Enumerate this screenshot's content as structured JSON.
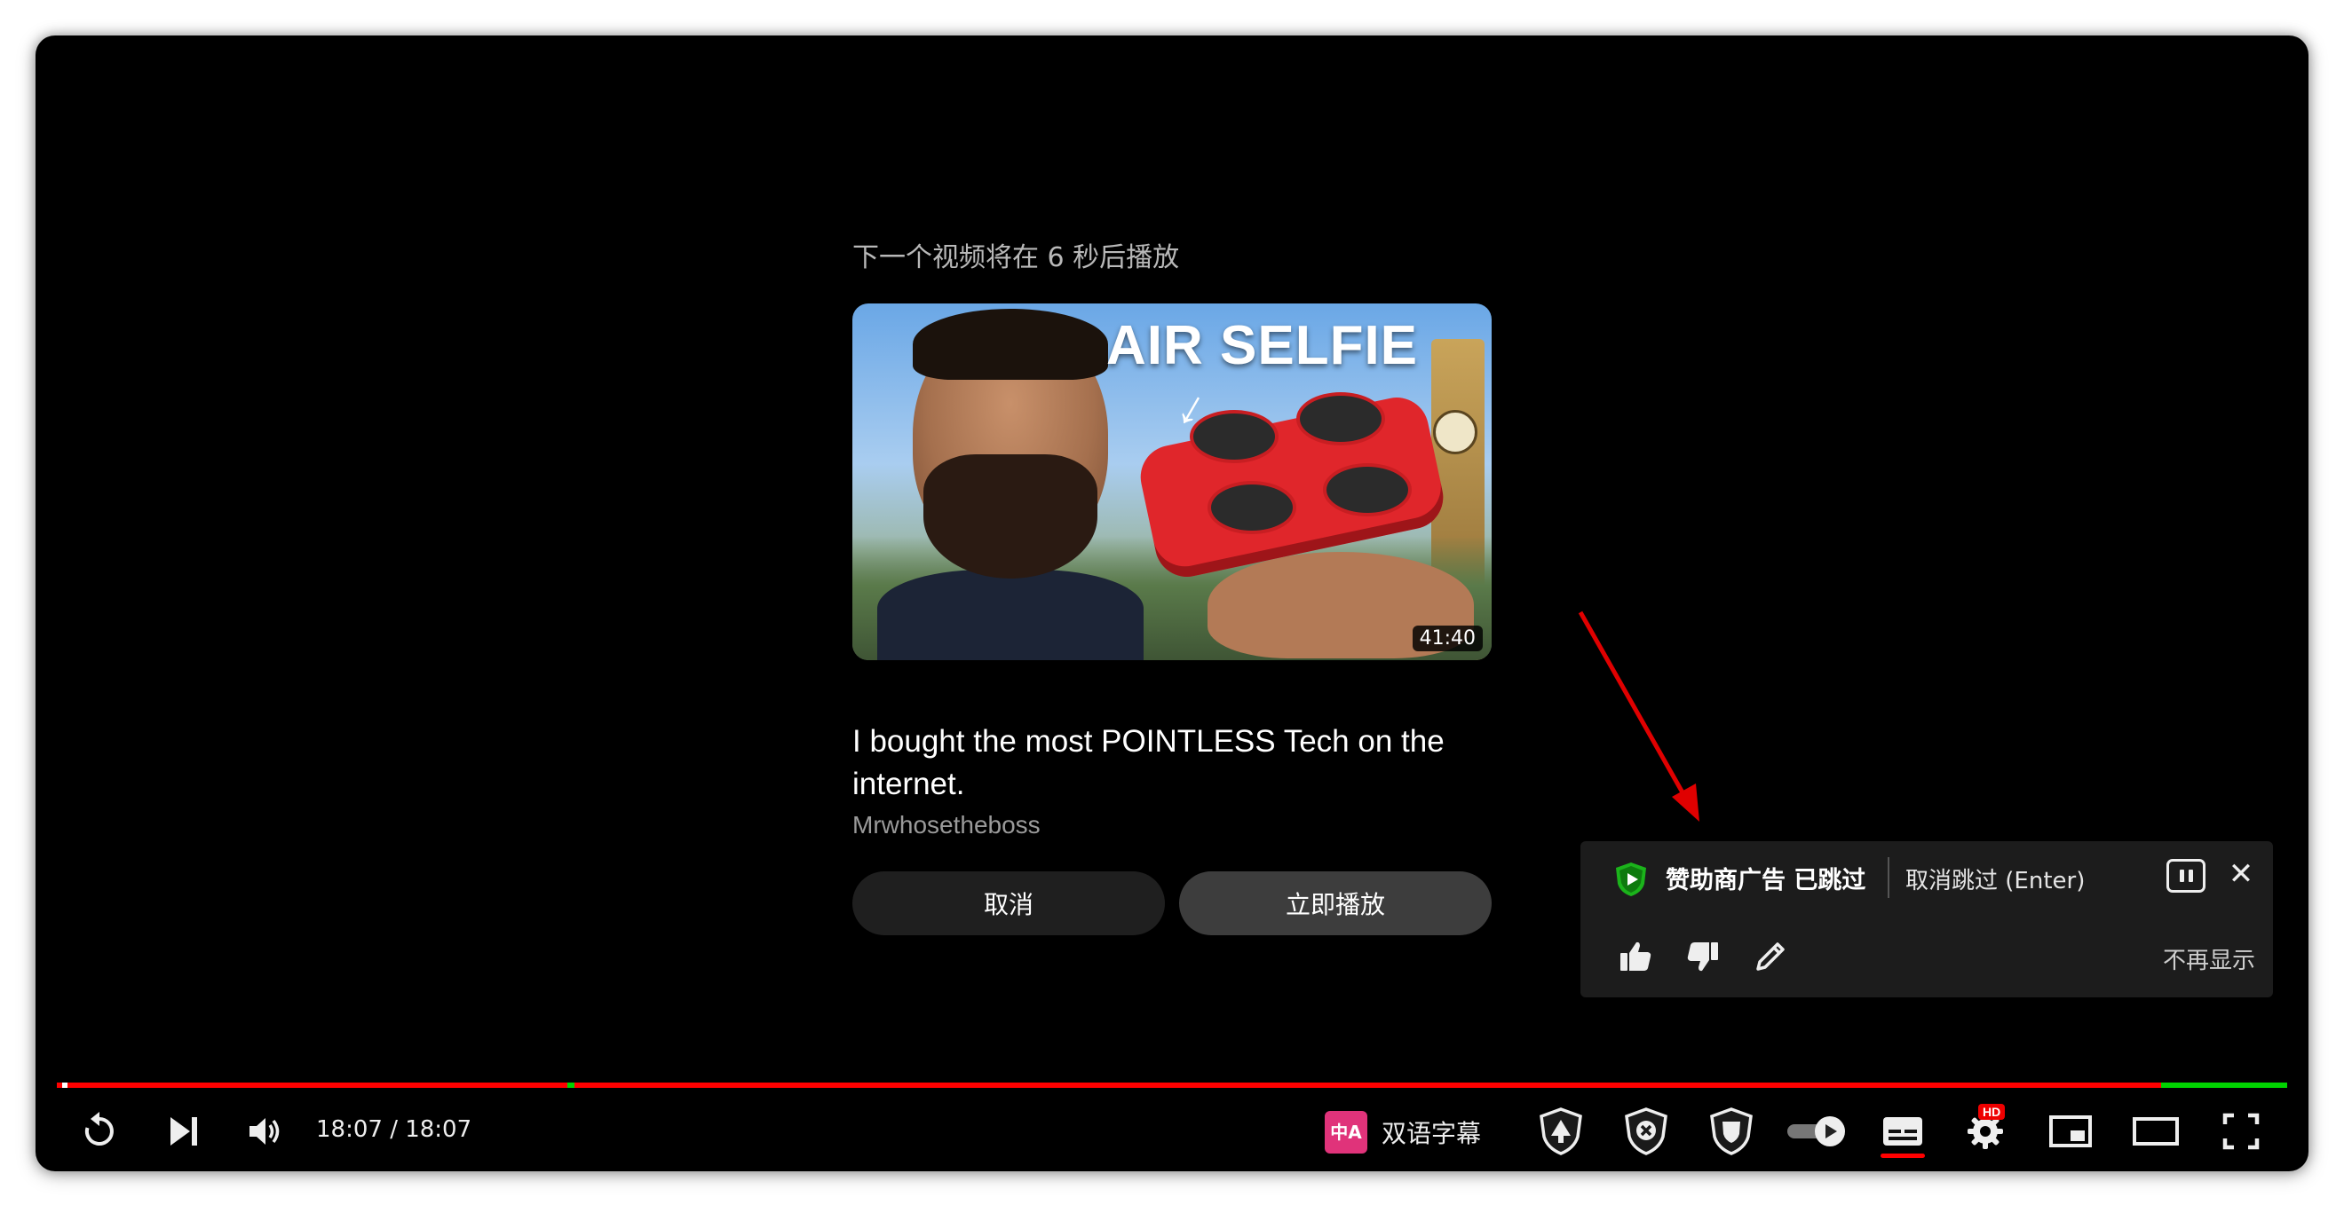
{
  "up_next": {
    "label": "下一个视频将在 6 秒后播放",
    "thumbnail_title": "AIR SELFIE",
    "duration": "41:40",
    "title": "I bought the most POINTLESS Tech on the internet.",
    "channel": "Mrwhosetheboss",
    "cancel_label": "取消",
    "play_now_label": "立即播放"
  },
  "sponsor_panel": {
    "status": "赞助商广告 已跳过",
    "undo_label": "取消跳过 (Enter)",
    "close_glyph": "✕",
    "dont_show_label": "不再显示",
    "shield_color": "#1bb31b"
  },
  "player": {
    "time_display": "18:07 / 18:07",
    "bilingual_label": "双语字幕",
    "bilingual_icon_text": "中A",
    "hd_badge": "HD",
    "progress_played_fraction": 1.0,
    "accent_color": "#ff0000"
  }
}
